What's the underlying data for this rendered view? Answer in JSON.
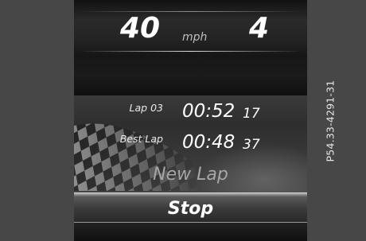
{
  "figure_code": "P54.33-4291-31",
  "dash": {
    "speed": "40",
    "unit": "mph",
    "gear": "4"
  },
  "laps": {
    "current_label": "Lap 03",
    "current_time": "00:52",
    "current_fraction": "17",
    "best_label": "Best Lap",
    "best_time": "00:48",
    "best_fraction": "37"
  },
  "menu": {
    "new_lap": "New Lap",
    "stop": "Stop"
  },
  "icons": {
    "flag": "checkered-flag-icon"
  }
}
